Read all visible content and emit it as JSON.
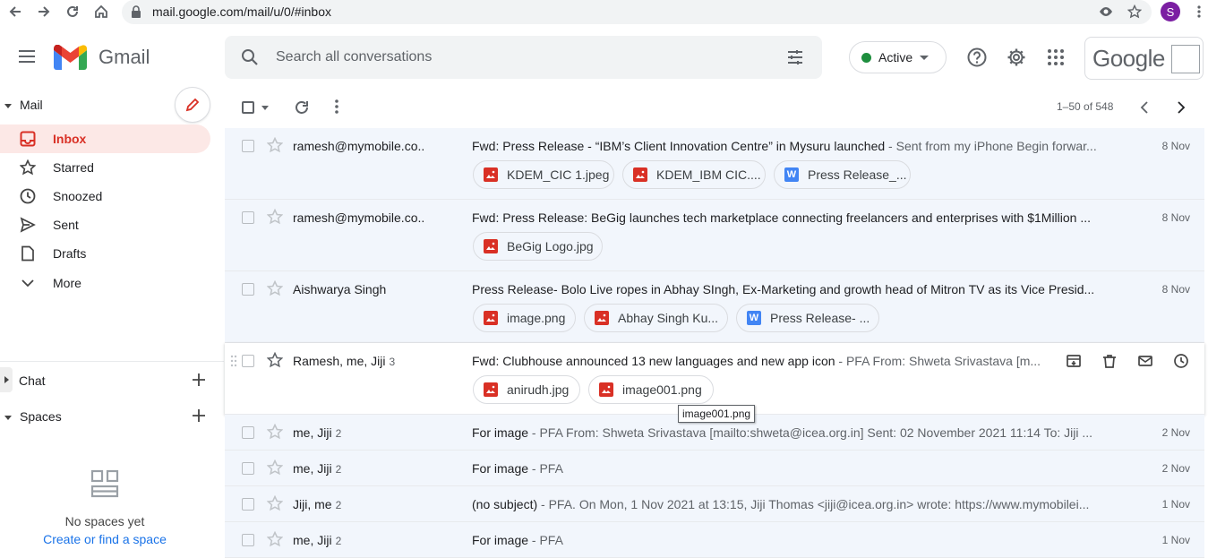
{
  "browser": {
    "url": "mail.google.com/mail/u/0/#inbox",
    "avatar_letter": "S"
  },
  "header": {
    "app_name": "Gmail",
    "search_placeholder": "Search all conversations",
    "status_label": "Active",
    "brand_text": "Google"
  },
  "sidebar": {
    "mail_section": "Mail",
    "items": [
      {
        "label": "Inbox",
        "icon": "inbox-icon"
      },
      {
        "label": "Starred",
        "icon": "star-icon"
      },
      {
        "label": "Snoozed",
        "icon": "clock-icon"
      },
      {
        "label": "Sent",
        "icon": "send-icon"
      },
      {
        "label": "Drafts",
        "icon": "draft-icon"
      },
      {
        "label": "More",
        "icon": "chevron-down-icon"
      }
    ],
    "chat_section": "Chat",
    "spaces_section": "Spaces",
    "no_spaces": "No spaces yet",
    "create_space_link": "Create or find a space"
  },
  "toolbar": {
    "pagination": "1–50 of 548"
  },
  "emails": [
    {
      "sender": "ramesh@mymobile.co..",
      "count": "",
      "subject": "Fwd: Press Release - “IBM’s Client Innovation Centre” in Mysuru launched",
      "snippet": " - Sent from my iPhone Begin forwar...",
      "date": "8 Nov",
      "attachments": [
        {
          "name": "KDEM_CIC 1.jpeg",
          "type": "image"
        },
        {
          "name": "KDEM_IBM CIC....",
          "type": "image"
        },
        {
          "name": "Press Release_...",
          "type": "doc"
        }
      ]
    },
    {
      "sender": "ramesh@mymobile.co..",
      "count": "",
      "subject": "Fwd: Press Release: BeGig launches tech marketplace connecting freelancers and enterprises with $1Million ...",
      "snippet": "",
      "date": "8 Nov",
      "attachments": [
        {
          "name": "BeGig Logo.jpg",
          "type": "image"
        }
      ]
    },
    {
      "sender": "Aishwarya Singh",
      "count": "",
      "subject": "Press Release- Bolo Live ropes in Abhay SIngh, Ex-Marketing and growth head of Mitron TV as its Vice Presid...",
      "snippet": "",
      "date": "8 Nov",
      "attachments": [
        {
          "name": "image.png",
          "type": "image"
        },
        {
          "name": "Abhay Singh Ku...",
          "type": "image"
        },
        {
          "name": "Press Release- ...",
          "type": "doc"
        }
      ]
    },
    {
      "sender": "Ramesh, me, Jiji",
      "count": "3",
      "subject": "Fwd: Clubhouse announced 13 new languages and new app icon",
      "snippet": " - PFA From: Shweta Srivastava [m...",
      "date": "",
      "attachments": [
        {
          "name": "anirudh.jpg",
          "type": "image"
        },
        {
          "name": "image001.png",
          "type": "image"
        }
      ]
    },
    {
      "sender": "me, Jiji",
      "count": "2",
      "subject": "For image",
      "snippet": " - PFA From: Shweta Srivastava [mailto:shweta@icea.org.in] Sent: 02 November 2021 11:14 To: Jiji ...",
      "date": "2 Nov",
      "attachments": []
    },
    {
      "sender": "me, Jiji",
      "count": "2",
      "subject": "For image",
      "snippet": " - PFA",
      "date": "2 Nov",
      "attachments": []
    },
    {
      "sender": "Jiji, me",
      "count": "2",
      "subject": "(no subject)",
      "snippet": " - PFA. On Mon, 1 Nov 2021 at 13:15, Jiji Thomas <jiji@icea.org.in> wrote: https://www.mymobilei...",
      "date": "1 Nov",
      "attachments": []
    },
    {
      "sender": "me, Jiji",
      "count": "2",
      "subject": "For image",
      "snippet": " - PFA",
      "date": "1 Nov",
      "attachments": []
    }
  ],
  "tooltip": "image001.png",
  "colors": {
    "accent_red": "#d93025",
    "selected_bg": "#fce8e6",
    "link_blue": "#1a73e8"
  }
}
